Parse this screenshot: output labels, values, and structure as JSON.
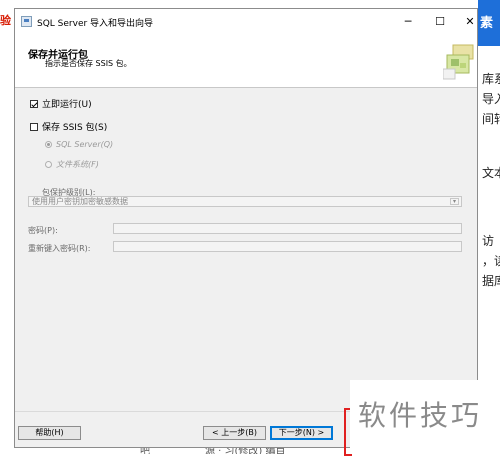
{
  "background": {
    "left_text": "验",
    "right_top_text": "素",
    "right_lines": [
      "库系",
      "导入",
      "间转",
      "文本",
      "访",
      "，读",
      "据库"
    ],
    "bottom_left": "吧",
    "bottom_right": "源 · 习(修改) 编目"
  },
  "watermark": "软件技巧",
  "window": {
    "title": "SQL Server 导入和导出向导",
    "controls": {
      "minimize": "─",
      "maximize": "☐",
      "close": "✕"
    }
  },
  "header": {
    "title": "保存并运行包",
    "subtitle": "指示是否保存 SSIS 包。",
    "art_icon": "package-folder-icon"
  },
  "options": {
    "run_immediately": {
      "label": "立即运行(U)",
      "checked": true
    },
    "save_ssis": {
      "label": "保存 SSIS 包(S)",
      "checked": false
    },
    "sql_server": {
      "label": "SQL Server(Q)",
      "selected": true
    },
    "file_system": {
      "label": "文件系统(F)",
      "selected": false
    }
  },
  "protection": {
    "label": "包保护级别(L):",
    "value": "使用用户密钥加密敏感数据"
  },
  "password": {
    "label": "密码(P):",
    "value": ""
  },
  "retype_password": {
    "label": "重新键入密码(R):",
    "value": ""
  },
  "buttons": {
    "help": "帮助(H)",
    "back": "< 上一步(B)",
    "next": "下一步(N) >"
  }
}
